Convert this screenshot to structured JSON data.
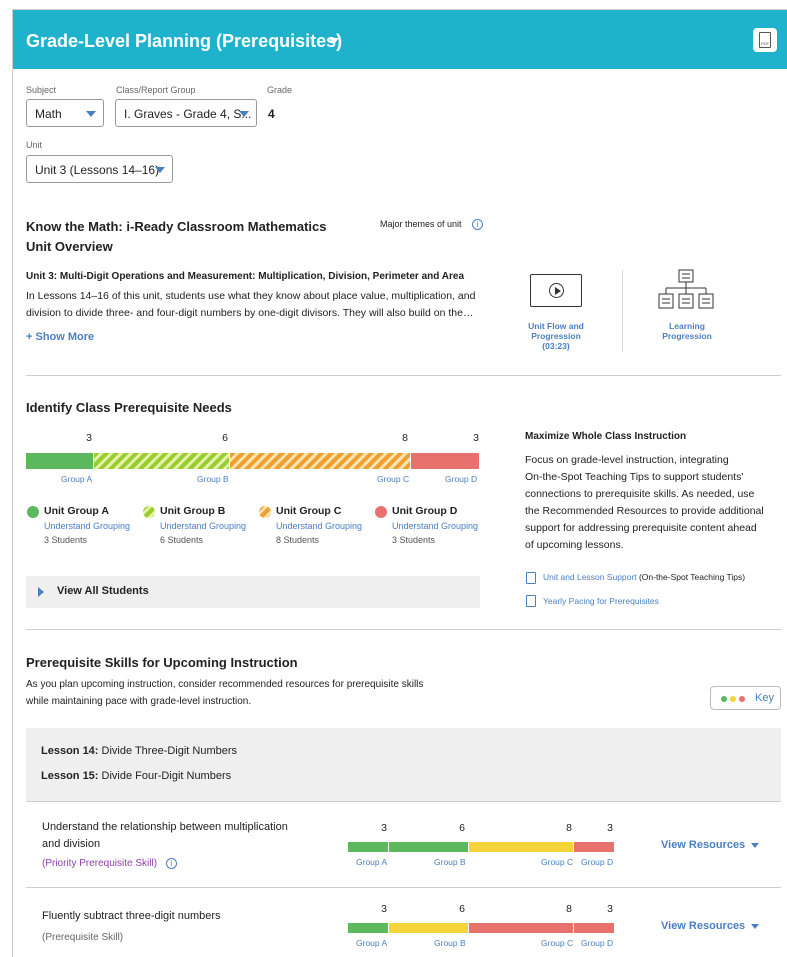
{
  "header": {
    "title": "Grade-Level Planning (Prerequisites)",
    "pdf_label": "PDF"
  },
  "filters": {
    "subject": {
      "label": "Subject",
      "value": "Math"
    },
    "class_group": {
      "label": "Class/Report Group",
      "value": "I. Graves - Grade 4, S..."
    },
    "grade": {
      "label": "Grade",
      "value": "4"
    },
    "unit": {
      "label": "Unit",
      "value": "Unit 3 (Lessons 14–16)"
    }
  },
  "know_math": {
    "title_line1": "Know the Math: i-Ready Classroom Mathematics",
    "title_line2": "Unit Overview",
    "major_themes": "Major themes of unit",
    "unit_heading": "Unit 3: Multi-Digit Operations and Measurement: Multiplication, Division, Perimeter and Area",
    "desc_line1": "In Lessons 14–16 of this unit, students use what they know about place value, multiplication, and",
    "desc_line2": "division to divide three- and four-digit numbers by one-digit divisors. They will also build on the…",
    "show_more": "+ Show More",
    "video_label_1": "Unit Flow and",
    "video_label_2": "Progression",
    "video_label_3": "(03:23)",
    "learning_1": "Learning",
    "learning_2": "Progression"
  },
  "class_needs": {
    "title": "Identify Class Prerequisite Needs",
    "groups": [
      {
        "bar_label": "Group A",
        "count": "3",
        "name": "Unit Group A",
        "link": "Understand Grouping",
        "students": "3 Students",
        "fraction": 0.15
      },
      {
        "bar_label": "Group B",
        "count": "6",
        "name": "Unit Group B",
        "link": "Understand Grouping",
        "students": "6 Students",
        "fraction": 0.3
      },
      {
        "bar_label": "Group C",
        "count": "8",
        "name": "Unit Group C",
        "link": "Understand Grouping",
        "students": "8 Students",
        "fraction": 0.4
      },
      {
        "bar_label": "Group D",
        "count": "3",
        "name": "Unit Group D",
        "link": "Understand Grouping",
        "students": "3 Students",
        "fraction": 0.15
      }
    ],
    "view_all": "View All Students",
    "maximize_title": "Maximize Whole Class Instruction",
    "maximize_lines": [
      "Focus on grade-level instruction, integrating",
      "On-the-Spot Teaching Tips to support students'",
      "connections to prerequisite skills. As needed, use",
      "the Recommended Resources to provide additional",
      "support for addressing prerequisite content ahead",
      "of upcoming lessons."
    ],
    "link1": "Unit and Lesson Support",
    "link1_suffix": "(On-the-Spot Teaching Tips)",
    "link2": "Yearly Pacing for Prerequisites"
  },
  "prereq": {
    "title": "Prerequisite Skills for Upcoming Instruction",
    "desc_line1": "As you plan upcoming instruction, consider recommended resources for prerequisite skills",
    "desc_line2": "while maintaining pace with grade-level instruction.",
    "key_label": "Key",
    "lessons": [
      {
        "num": "Lesson 14:",
        "name": "Divide Three-Digit Numbers"
      },
      {
        "num": "Lesson 15:",
        "name": "Divide Four-Digit Numbers"
      }
    ],
    "skills": [
      {
        "line1": "Understand the relationship between multiplication",
        "line2": "and division",
        "tag": "(Priority Prerequisite Skill)",
        "counts": [
          "3",
          "6",
          "8",
          "3"
        ],
        "group_labels": [
          "Group A",
          "Group B",
          "Group C",
          "Group D"
        ],
        "statuses": [
          "green",
          "green",
          "yellow",
          "red"
        ],
        "view": "View Resources"
      },
      {
        "line1": "Fluently subtract three-digit numbers",
        "line2": "",
        "tag": "(Prerequisite Skill)",
        "counts": [
          "3",
          "6",
          "8",
          "3"
        ],
        "group_labels": [
          "Group A",
          "Group B",
          "Group C",
          "Group D"
        ],
        "statuses": [
          "green",
          "yellow",
          "red",
          "red"
        ],
        "view": "View Resources"
      }
    ]
  },
  "colors": {
    "header": "#1fb2cc",
    "link": "#4a7fc1",
    "green": "#5cb85c",
    "yellow": "#f5d43a",
    "red": "#e8716d",
    "priority": "#8e3fa8"
  }
}
